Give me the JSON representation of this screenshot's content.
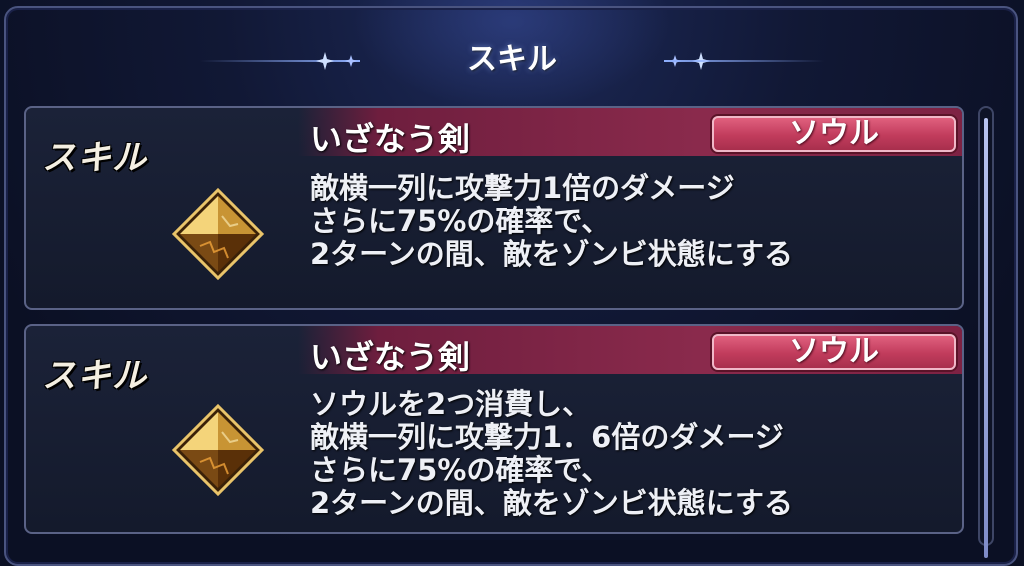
{
  "header": {
    "title": "スキル"
  },
  "skills": [
    {
      "tag": "スキル",
      "icon": "amber-gem-icon",
      "name": "いざなう剣",
      "badge": "ソウル",
      "description": [
        "敵横一列に攻撃力1倍のダメージ",
        "さらに75%の確率で、",
        "2ターンの間、敵をゾンビ状態にする"
      ]
    },
    {
      "tag": "スキル",
      "icon": "amber-gem-icon",
      "name": "いざなう剣",
      "badge": "ソウル",
      "description": [
        "ソウルを2つ消費し、",
        "敵横一列に攻撃力1．6倍のダメージ",
        "さらに75%の確率で、",
        "2ターンの間、敵をゾンビ状態にする"
      ]
    }
  ],
  "colors": {
    "background": "#0b1024",
    "card": "#1b2238",
    "name_band": "#8a2a4c",
    "badge": "#c13c5c",
    "text": "#eef0f6"
  }
}
